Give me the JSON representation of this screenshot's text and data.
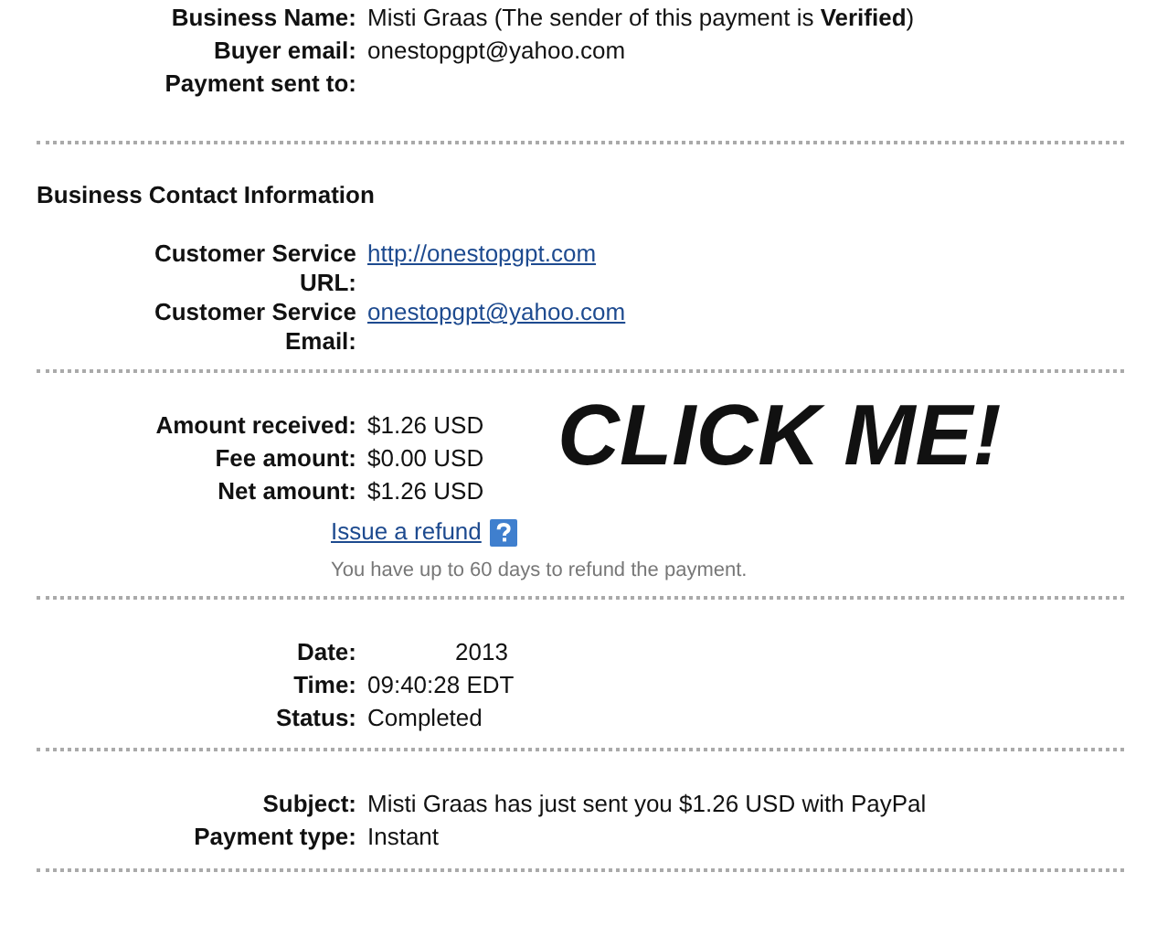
{
  "sections": [
    {
      "rows": [
        {
          "kind": "text",
          "label": "Business Name:",
          "value": "Misti Graas (The sender of this payment is **Verified**)"
        },
        {
          "kind": "text",
          "label": "Buyer email:",
          "value": "onestopgpt@yahoo.com"
        },
        {
          "kind": "empty",
          "label": "Payment sent to:"
        }
      ]
    },
    {
      "heading": "Business Contact Information",
      "rows": [
        {
          "kind": "link",
          "label": "Customer Service URL:",
          "value": "http://onestopgpt.com"
        },
        {
          "kind": "link",
          "label": "Customer Service Email:",
          "value": "onestopgpt@yahoo.com"
        }
      ]
    },
    {
      "banner": "CLICK ME!",
      "rows": [
        {
          "kind": "text",
          "label": "Amount received:",
          "value": "$1.26 USD"
        },
        {
          "kind": "text",
          "label": "Fee amount:",
          "value": "$0.00 USD"
        },
        {
          "kind": "text",
          "label": "Net amount:",
          "value": "$1.26 USD"
        }
      ],
      "refund_link": "Issue a refund",
      "refund_note": "You have up to 60 days to refund the payment."
    },
    {
      "rows": [
        {
          "kind": "indented",
          "label": "Date:",
          "value": "2013"
        },
        {
          "kind": "text",
          "label": "Time:",
          "value": "09:40:28 EDT"
        },
        {
          "kind": "text",
          "label": "Status:",
          "value": "Completed"
        }
      ]
    },
    {
      "rows": [
        {
          "kind": "text",
          "label": "Subject:",
          "value": "Misti Graas has just sent you $1.26 USD with PayPal"
        },
        {
          "kind": "text",
          "label": "Payment type:",
          "value": "Instant"
        }
      ]
    }
  ]
}
